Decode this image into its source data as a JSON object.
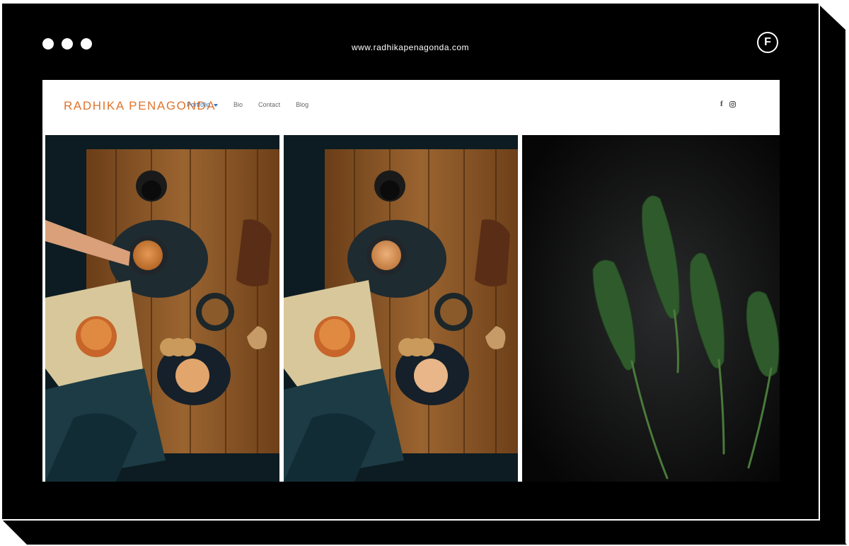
{
  "browser": {
    "url": "www.radhikapenagonda.com",
    "brand_badge": "F"
  },
  "site": {
    "logo": "RADHIKA PENAGONDA",
    "accent_color": "#e0732d",
    "link_color": "#2e7bbf",
    "nav": [
      {
        "label": "Portfolio",
        "active": true,
        "has_dropdown": true
      },
      {
        "label": "Bio"
      },
      {
        "label": "Contact"
      },
      {
        "label": "Blog"
      }
    ],
    "social_icons": [
      "facebook-icon",
      "instagram-icon"
    ]
  },
  "gallery": {
    "photos": [
      {
        "subject": "masala-chai-flatlay-with-hand"
      },
      {
        "subject": "masala-chai-flatlay"
      },
      {
        "subject": "sage-leaves-on-dark"
      }
    ]
  }
}
